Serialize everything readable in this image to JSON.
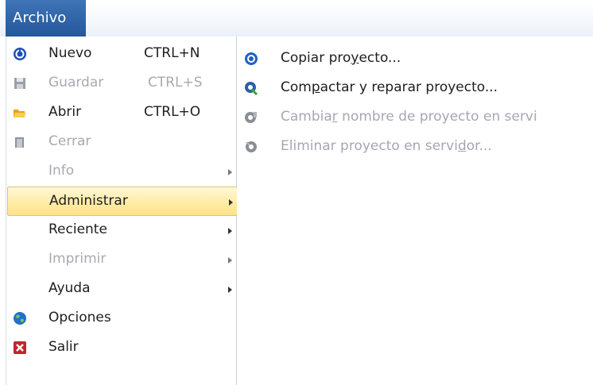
{
  "tab": {
    "label": "Archivo"
  },
  "menu": [
    {
      "label": "Nuevo",
      "shortcut": "CTRL+N",
      "enabled": true,
      "icon": "new-project-icon"
    },
    {
      "label": "Guardar",
      "shortcut": "CTRL+S",
      "enabled": false,
      "icon": "save-icon"
    },
    {
      "label": "Abrir",
      "shortcut": "CTRL+O",
      "enabled": true,
      "icon": "open-folder-icon"
    },
    {
      "label": "Cerrar",
      "shortcut": "",
      "enabled": false,
      "icon": "close-door-icon"
    },
    {
      "label": "Info",
      "enabled": false,
      "submenu": true
    },
    {
      "label": "Administrar",
      "enabled": true,
      "submenu": true,
      "selected": true
    },
    {
      "label": "Reciente",
      "enabled": true,
      "submenu": true
    },
    {
      "label": "Imprimir",
      "enabled": false,
      "submenu": true
    },
    {
      "label": "Ayuda",
      "enabled": true,
      "submenu": true
    },
    {
      "label": "Opciones",
      "enabled": true,
      "icon": "options-globe-icon"
    },
    {
      "label": "Salir",
      "enabled": true,
      "icon": "exit-x-icon"
    }
  ],
  "submenu": [
    {
      "pre": "Copiar pro",
      "mn": "y",
      "post": "ecto...",
      "enabled": true,
      "icon": "copy-project-icon"
    },
    {
      "pre": "Com",
      "mn": "p",
      "post": "actar y reparar proyecto...",
      "enabled": true,
      "icon": "compact-repair-icon"
    },
    {
      "pre": "Cambia",
      "mn": "r",
      "post": " nombre de proyecto en servi",
      "enabled": false,
      "icon": "rename-server-icon"
    },
    {
      "pre": "Eliminar proyecto en servi",
      "mn": "d",
      "post": "or...",
      "enabled": false,
      "icon": "delete-server-icon"
    }
  ],
  "colors": {
    "accent": "#2f64a8",
    "highlight": "#ffe9a0",
    "disabled_text": "#a9a9b1"
  }
}
